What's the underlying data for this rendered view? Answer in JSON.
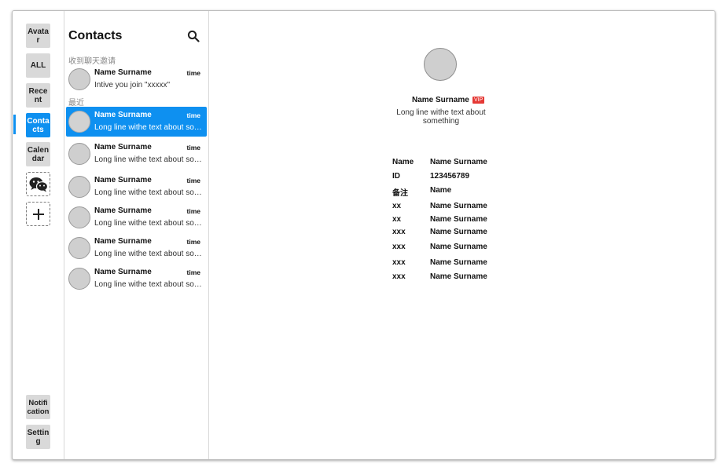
{
  "rail": {
    "top_items": [
      {
        "id": "avatar",
        "label": "Avatar",
        "active": false
      },
      {
        "id": "all",
        "label": "ALL",
        "active": false
      },
      {
        "id": "recent",
        "label": "Recent",
        "active": false
      },
      {
        "id": "contacts",
        "label": "Contacts",
        "active": true
      },
      {
        "id": "calendar",
        "label": "Calendar",
        "active": false
      }
    ],
    "app_icon": "wechat-icon",
    "add_icon": "plus-icon",
    "bottom_items": [
      {
        "id": "notification",
        "label": "Notification"
      },
      {
        "id": "setting",
        "label": "Setting"
      }
    ],
    "accent_color": "#0e90f0"
  },
  "contacts": {
    "title": "Contacts",
    "search_icon": "search-icon",
    "invites_label": "收到聊天邀请",
    "recent_label": "最近",
    "invites": [
      {
        "name": "Name Surname",
        "time": "time",
        "message": "Intive you join \"xxxxx\"",
        "selected": false
      }
    ],
    "recent": [
      {
        "name": "Name Surname",
        "time": "time",
        "message": "Long line withe text about something",
        "selected": true
      },
      {
        "name": "Name Surname",
        "time": "time",
        "message": "Long line withe text about something",
        "selected": false
      },
      {
        "name": "Name Surname",
        "time": "time",
        "message": "Long line withe text about something",
        "selected": false
      },
      {
        "name": "Name Surname",
        "time": "time",
        "message": "Long line withe text about something",
        "selected": false
      },
      {
        "name": "Name Surname",
        "time": "time",
        "message": "Long line withe text about something",
        "selected": false
      },
      {
        "name": "Name Surname",
        "time": "time",
        "message": "Long line withe text about something",
        "selected": false
      }
    ]
  },
  "detail": {
    "name": "Name Surname",
    "badge": "VIP",
    "badge_color": "#e53935",
    "description": "Long line withe text about something",
    "fields": [
      {
        "key": "Name",
        "value": "Name Surname"
      },
      {
        "key": "ID",
        "value": "123456789"
      },
      {
        "key": "备注",
        "value": "Name"
      },
      {
        "key": "xx",
        "value": "Name Surname"
      },
      {
        "key": "xx",
        "value": "Name Surname"
      },
      {
        "key": "xxx",
        "value": "Name Surname"
      },
      {
        "key": "xxx",
        "value": "Name Surname"
      },
      {
        "key": "xxx",
        "value": "Name Surname"
      },
      {
        "key": "xxx",
        "value": "Name Surname"
      }
    ]
  }
}
